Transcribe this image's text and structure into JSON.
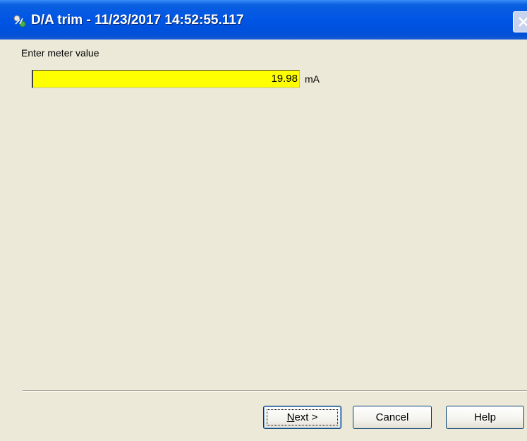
{
  "window": {
    "title": "D/A trim - 11/23/2017 14:52:55.117",
    "icon": "device-config-icon"
  },
  "form": {
    "label": "Enter meter value",
    "value": "19.98",
    "unit": "mA",
    "field_color": "#ffff00"
  },
  "buttons": {
    "next_mnemonic": "N",
    "next_rest": "ext >",
    "cancel": "Cancel",
    "help": "Help"
  }
}
